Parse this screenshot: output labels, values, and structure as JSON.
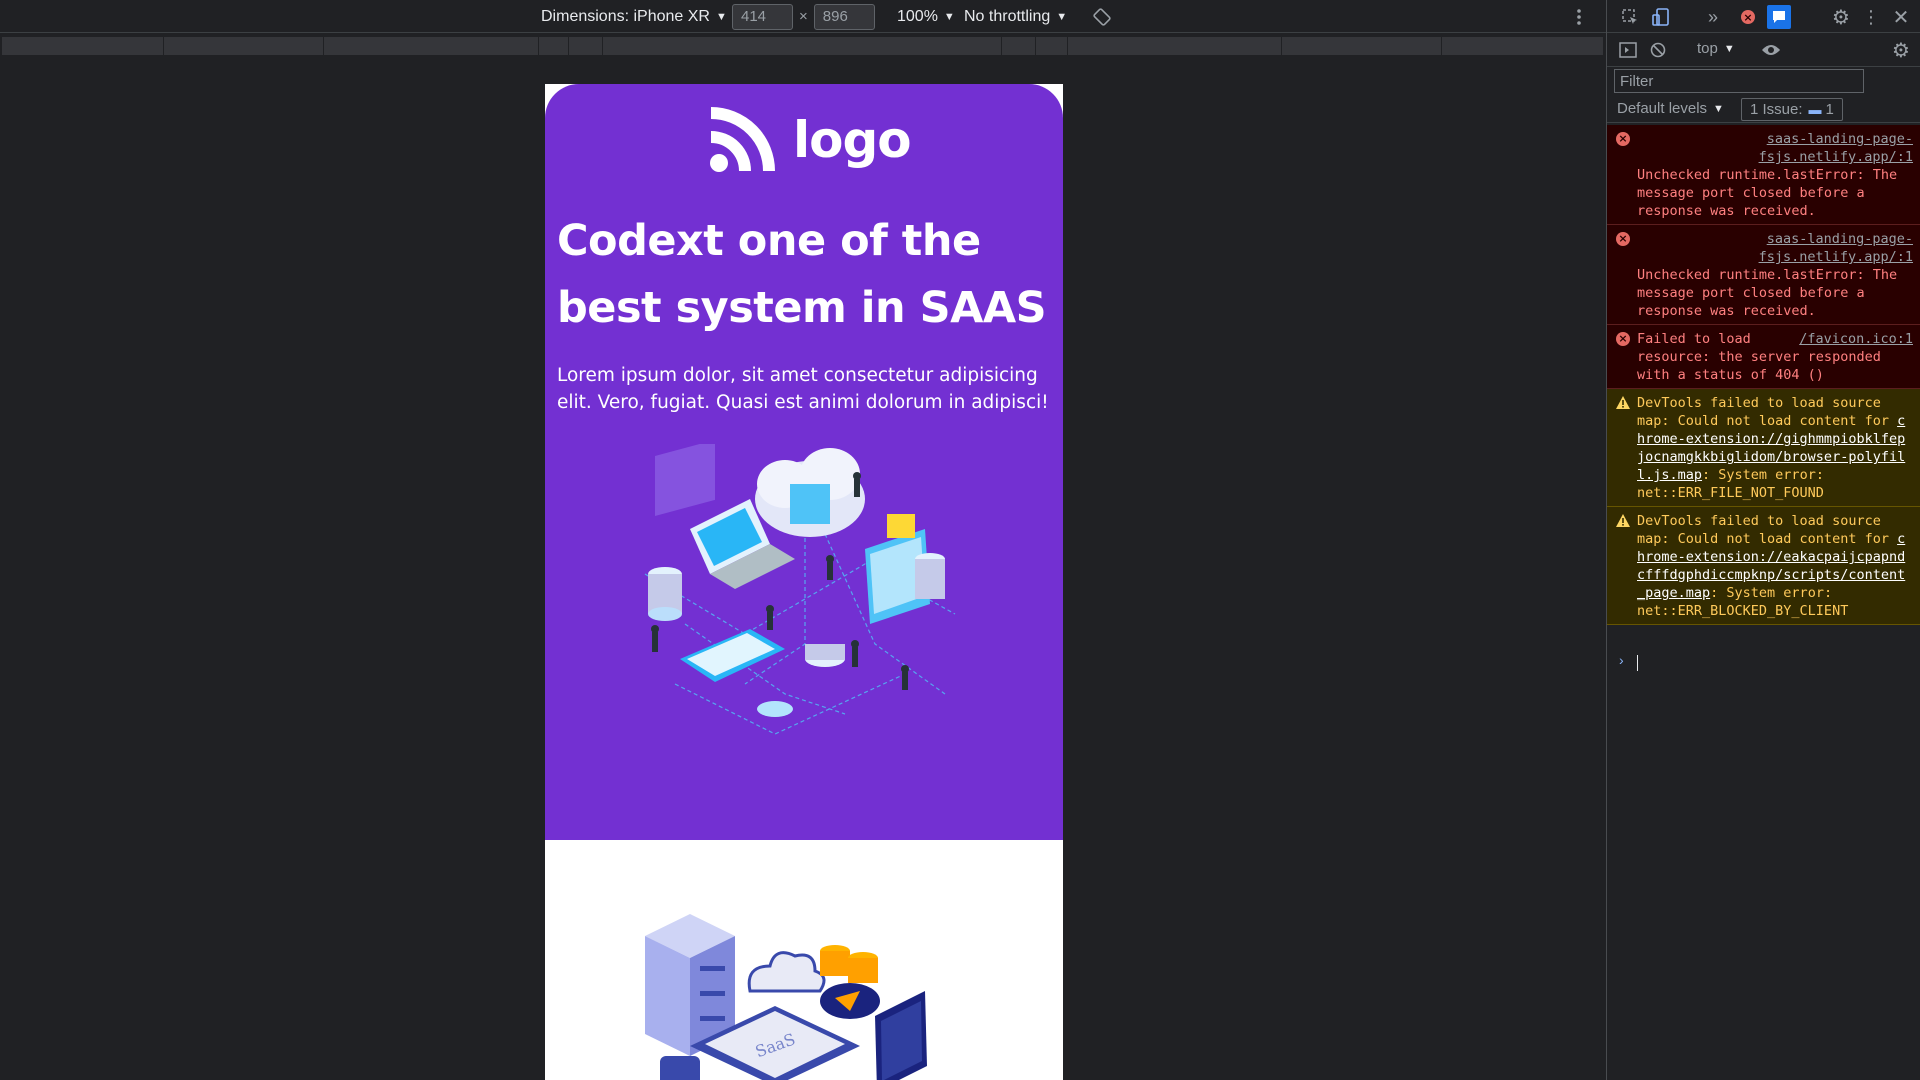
{
  "device_toolbar": {
    "dimensions_label": "Dimensions: iPhone XR",
    "width_value": "414",
    "height_value": "896",
    "times_sign": "×",
    "zoom": "100%",
    "throttling": "No throttling",
    "icons": [
      "caret-down-icon",
      "rotate-icon",
      "more-vertical-icon"
    ]
  },
  "page": {
    "logo_text": "logo",
    "hero_title": "Codext one of the best system in SAAS",
    "hero_description": "Lorem ipsum dolor, sit amet consectetur adipisicing elit. Vero, fugiat. Quasi est animi dolorum in adipisci!",
    "hero_color": "#7330d2",
    "saas_label": "SaaS"
  },
  "devtools": {
    "context": "top",
    "filter_placeholder": "Filter",
    "default_levels": "Default levels",
    "issues_label": "1 Issue:",
    "issues_count": "1",
    "messages": [
      {
        "level": "error",
        "source": "saas-landing-page-fsjs.netlify.app/:1",
        "text": "Unchecked runtime.lastError: The message port closed before a response was received."
      },
      {
        "level": "error",
        "source": "saas-landing-page-fsjs.netlify.app/:1",
        "text": "Unchecked runtime.lastError: The message port closed before a response was received."
      },
      {
        "level": "error",
        "source": "/favicon.ico:1",
        "text_lead": "Failed to load",
        "text": "resource: the server responded with a status of 404 ()"
      },
      {
        "level": "warning",
        "text_pre": "DevTools failed to load source map: Could not load content for ",
        "link": "chrome-extension://gighmmpiobklfepjocnamgkkbiglidom/browser-polyfill.js.map",
        "text_post": ": System error: net::ERR_FILE_NOT_FOUND"
      },
      {
        "level": "warning",
        "text_pre": "DevTools failed to load source map: Could not load content for ",
        "link": "chrome-extension://eakacpaijcpapndcfffdgphdiccmpknp/scripts/content_page.map",
        "text_post": ": System error: net::ERR_BLOCKED_BY_CLIENT"
      }
    ],
    "colors": {
      "error_bg": "#290000",
      "error_text": "#ff8080",
      "warning_bg": "#332b00",
      "warning_text": "#ffca5b"
    }
  }
}
